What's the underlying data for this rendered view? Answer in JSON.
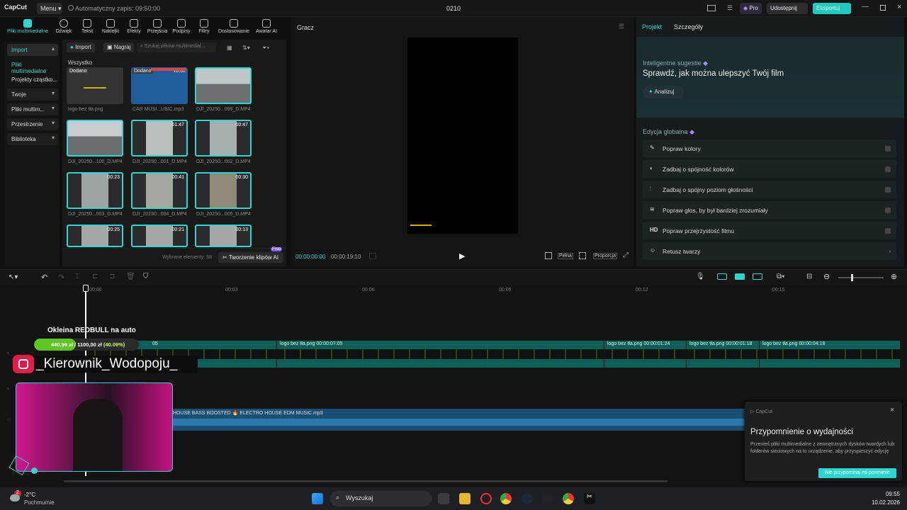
{
  "titlebar": {
    "logo": "CapCut",
    "menu_label": "Menu",
    "autosave": "Automatyczny zapis: 09:50:00",
    "project_title": "0210",
    "pro_label": "Pro",
    "share_label": "Udostępnij",
    "export_label": "Eksportuj"
  },
  "toolbar": {
    "tools": [
      {
        "label": "Pliki multimedialne",
        "icon": "media-icon"
      },
      {
        "label": "Dźwięk",
        "icon": "audio-icon"
      },
      {
        "label": "Tekst",
        "icon": "text-icon"
      },
      {
        "label": "Naklejki",
        "icon": "sticker-icon"
      },
      {
        "label": "Efekty",
        "icon": "effects-icon"
      },
      {
        "label": "Przejścia",
        "icon": "transitions-icon"
      },
      {
        "label": "Podpisy",
        "icon": "captions-icon"
      },
      {
        "label": "Filtry",
        "icon": "filters-icon"
      },
      {
        "label": "Dostosowanie",
        "icon": "adjust-icon"
      },
      {
        "label": "Awatar AI",
        "icon": "avatar-icon"
      }
    ]
  },
  "leftnav": {
    "items": [
      "Import",
      "Pliki multimedialne",
      "Projekty cząstko...",
      "Twoje",
      "Pliki multim...",
      "Przestrzenie",
      "Biblioteka"
    ]
  },
  "media": {
    "import_label": "Import",
    "record_label": "Nagraj",
    "search_placeholder": "Szukaj plików multimedial...",
    "section_label": "Wszystko",
    "added_label": "Dodano",
    "items": [
      {
        "name": "logo bez tła.png",
        "duration": ""
      },
      {
        "name": "CAR MUSI...USIC.mp3",
        "duration": "10:02"
      },
      {
        "name": "DJI_20250...099_D.MP4",
        "duration": ""
      },
      {
        "name": "DJI_20250...100_D.MP4",
        "duration": ""
      },
      {
        "name": "DJI_20250...001_D.MP4",
        "duration": "01:47"
      },
      {
        "name": "DJI_20250...002_D.MP4",
        "duration": "00:47"
      },
      {
        "name": "DJI_20250...003_D.MP4",
        "duration": "00:23"
      },
      {
        "name": "DJI_20250...004_D.MP4",
        "duration": "00:41"
      },
      {
        "name": "DJI_20250...005_D.MP4",
        "duration": "00:30"
      },
      {
        "name": "",
        "duration": "00:25"
      },
      {
        "name": "",
        "duration": "00:21"
      },
      {
        "name": "",
        "duration": "00:13"
      }
    ],
    "selected_count": "Wybrane elementy: 58",
    "ai_clips_label": "Tworzenie klipów AI",
    "free_badge": "Free"
  },
  "player": {
    "title": "Gracz",
    "current_time": "00:00:00:00",
    "total_time": "00:00:19:10",
    "full_label": "Pełna",
    "ratio_label": "Proporcja"
  },
  "right": {
    "tab_project": "Projekt",
    "tab_details": "Szczegóły",
    "smart_label": "Inteligentne sugestie",
    "smart_title": "Sprawdź, jak można ulepszyć Twój film",
    "analyze_label": "Analizuj",
    "global_label": "Edycja globalna",
    "global_items": [
      {
        "label": "Popraw kolory",
        "icon": "wand-icon"
      },
      {
        "label": "Zadbaj o spójność kolorów",
        "icon": "palette-icon"
      },
      {
        "label": "Zadbaj o spójny poziom głośności",
        "icon": "sliders-icon"
      },
      {
        "label": "Popraw głos, by był bardziej zrozumiały",
        "icon": "voice-icon"
      },
      {
        "label": "Popraw przejrzystość filmu",
        "icon": "hd-icon"
      },
      {
        "label": "Retusz twarzy",
        "icon": "face-icon"
      }
    ]
  },
  "timeline": {
    "ruler": [
      "00:00",
      "00:03",
      "00:06",
      "00:09",
      "00:12",
      "00:15"
    ],
    "clips": [
      {
        "label": "05"
      },
      {
        "label": "logo bez tła.png  00:00:07:05"
      },
      {
        "label": "logo bez tła.png  00:00:01:24"
      },
      {
        "label": "logo bez tła.png  00:00:01:18"
      },
      {
        "label": "logo bez tła.png  00:00:04:18"
      }
    ],
    "audio_label": "HOUSE BASS BOOSTED 🔥 ELECTRO HOUSE EDM MUSIC.mp3"
  },
  "overlay": {
    "goal_title": "Okleina REDBULL na auto",
    "goal_text": "440,99 zł / 1100,00 zł",
    "goal_pct": "(40.09%)",
    "goal_progress": 0.4009,
    "instagram_handle": "_Kierownik_Wodopoju_"
  },
  "popup": {
    "brand": "CapCut",
    "title": "Przypomnienie o wydajności",
    "body": "Przenieś pliki multimedialne z zewnętrznych dysków twardych lub folderów sieciowych na to urządzenie, aby przyspieszyć edycję",
    "button": "Nie przypominaj mi ponownie"
  },
  "taskbar": {
    "weather_temp": "-2°C",
    "weather_desc": "Pochmurnie",
    "weather_badge": "2",
    "search_label": "Wyszukaj",
    "time": "09:55",
    "date": "10.02.2026"
  },
  "colors": {
    "accent": "#2fd6d0",
    "export": "#20c9c0",
    "purple": "#8a5cff"
  }
}
